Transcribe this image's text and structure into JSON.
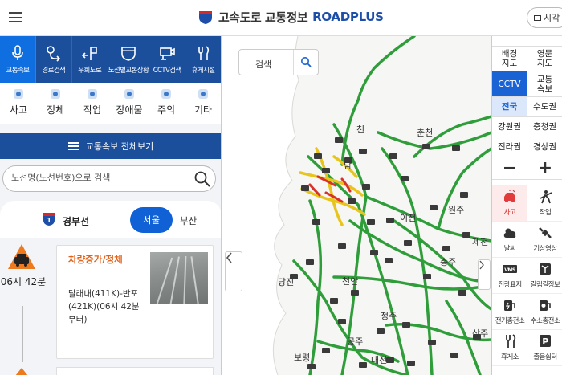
{
  "header": {
    "title": "고속도로 교통정보",
    "brand": "ROADPLUS",
    "view_button": "시각"
  },
  "menu": [
    {
      "label": "교통속보",
      "icon": "microphone-icon"
    },
    {
      "label": "경로검색",
      "icon": "route-icon"
    },
    {
      "label": "우회도로",
      "icon": "detour-icon"
    },
    {
      "label": "노선별교통상황",
      "icon": "route-shield-icon"
    },
    {
      "label": "CCTV검색",
      "icon": "cctv-icon"
    },
    {
      "label": "휴게시설",
      "icon": "rest-area-icon"
    }
  ],
  "categories": [
    "사고",
    "정체",
    "작업",
    "장애물",
    "주의",
    "기타"
  ],
  "all_view_label": "교통속보 전체보기",
  "search": {
    "placeholder": "노선명(노선번호)으로 검색"
  },
  "route": {
    "number": "1",
    "name": "경부선",
    "direction_a": "서울",
    "direction_b": "부산"
  },
  "incident": {
    "time": "06시 42분",
    "title": "차량증가/정체",
    "description": "달래내(411K)-반포(421K)(06시 42분부터)"
  },
  "map": {
    "search_label": "검색",
    "places": [
      "춘천",
      "천",
      "남",
      "이천",
      "원주",
      "제천",
      "충주",
      "당진",
      "천안",
      "청주",
      "공주",
      "대전",
      "보령",
      "상주"
    ]
  },
  "right_panel": {
    "map_types": [
      "배경지도",
      "영문지도"
    ],
    "modes": [
      "CCTV",
      "교통속보"
    ],
    "regions": [
      "전국",
      "수도권",
      "강원권",
      "충청권",
      "전라권",
      "경상권"
    ],
    "zoom_out": "−",
    "zoom_in": "+",
    "layers": [
      {
        "label": "사고",
        "icon": "accident-icon"
      },
      {
        "label": "작업",
        "icon": "work-icon"
      },
      {
        "label": "날씨",
        "icon": "weather-icon"
      },
      {
        "label": "기상영상",
        "icon": "weather-satellite-icon"
      },
      {
        "label": "전광표지",
        "icon": "vms-icon",
        "badge": "VMS"
      },
      {
        "label": "갈림길정보",
        "icon": "junction-icon"
      },
      {
        "label": "전기충전소",
        "icon": "ev-charger-icon"
      },
      {
        "label": "수소충전소",
        "icon": "hydrogen-charger-icon"
      },
      {
        "label": "휴게소",
        "icon": "rest-stop-icon"
      },
      {
        "label": "졸음쉼터",
        "icon": "parking-icon",
        "badge": "P"
      }
    ]
  },
  "colors": {
    "primary": "#1b4f9c",
    "accent": "#1060d6",
    "road_flow": "#2f9e3a",
    "road_slow": "#e8c51c",
    "road_jam": "#d9322b",
    "incident_title": "#e0621a"
  }
}
